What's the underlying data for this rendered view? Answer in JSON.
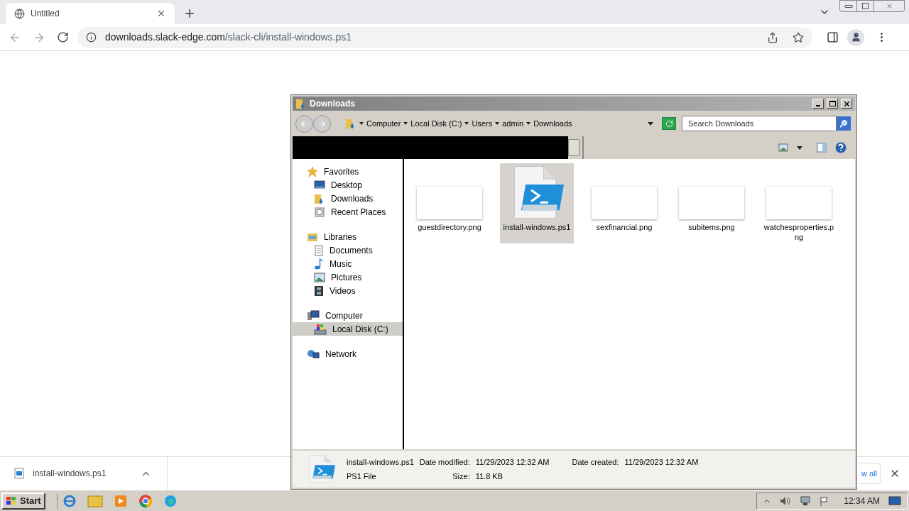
{
  "browser": {
    "tab": {
      "title": "Untitled",
      "selected": true
    },
    "url": {
      "host": "downloads.slack-edge.com",
      "path": "/slack-cli/install-windows.ps1"
    }
  },
  "explorer": {
    "title": "Downloads",
    "breadcrumb": [
      "Computer",
      "Local Disk (C:)",
      "Users",
      "admin",
      "Downloads"
    ],
    "search": {
      "placeholder": "Search Downloads"
    },
    "nav": [
      {
        "label": "Favorites",
        "kind": "star",
        "selected": false,
        "children": [
          {
            "label": "Desktop",
            "kind": "desktop",
            "selected": false
          },
          {
            "label": "Downloads",
            "kind": "folder",
            "selected": false
          },
          {
            "label": "Recent Places",
            "kind": "recent",
            "selected": false
          }
        ]
      },
      {
        "label": "Libraries",
        "kind": "library",
        "selected": false,
        "children": [
          {
            "label": "Documents",
            "kind": "doc",
            "selected": false
          },
          {
            "label": "Music",
            "kind": "music",
            "selected": false
          },
          {
            "label": "Pictures",
            "kind": "pictures",
            "selected": false
          },
          {
            "label": "Videos",
            "kind": "video",
            "selected": false
          }
        ]
      },
      {
        "label": "Computer",
        "kind": "computer",
        "selected": false,
        "children": [
          {
            "label": "Local Disk (C:)",
            "kind": "disk",
            "selected": true
          }
        ]
      },
      {
        "label": "Network",
        "kind": "network",
        "selected": false
      }
    ],
    "files": [
      {
        "name": "guestdirectory.png",
        "kind": "image",
        "selected": false
      },
      {
        "name": "install-windows.ps1",
        "kind": "script",
        "selected": true
      },
      {
        "name": "sexfinancial.png",
        "kind": "image",
        "selected": false
      },
      {
        "name": "subitems.png",
        "kind": "image",
        "selected": false
      },
      {
        "name": "watchesproperties.png",
        "kind": "image",
        "selected": false
      }
    ],
    "details": {
      "name": "install-windows.ps1",
      "type": "PS1 File",
      "modified_label": "Date modified:",
      "modified": "11/29/2023 12:32 AM",
      "created_label": "Date created:",
      "created": "11/29/2023 12:32 AM",
      "size_label": "Size:",
      "size": "11.8 KB"
    }
  },
  "download_shelf": {
    "item": "install-windows.ps1",
    "show_all": "w all"
  },
  "taskbar": {
    "start": "Start",
    "clock": "12:34 AM"
  }
}
